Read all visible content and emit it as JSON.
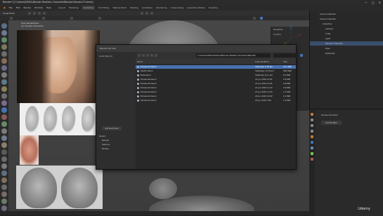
{
  "window": {
    "title": "Blender* [C:\\Users\\SAMI\\1\\Blender Realistic Character\\Blender\\Female-07.blend]",
    "controls": [
      "—",
      "□",
      "✕"
    ]
  },
  "menu": {
    "items": [
      "File",
      "Edit",
      "Render",
      "Window",
      "Help"
    ],
    "workspaces": [
      "Layout",
      "Modeling",
      "Sculpting",
      "UV Editing",
      "Texture Paint",
      "Shading",
      "Animation",
      "Rendering",
      "Compositing",
      "Geometry Nodes",
      "Scripting"
    ],
    "active_workspace": "Sculpting"
  },
  "viewport": {
    "mode": "Sculpt Mode",
    "overlay_text": [
      "User Perspective",
      "(1) Female Character"
    ],
    "mesh_name": "Female Character"
  },
  "file_dialog": {
    "title": "Blender File View",
    "path": "C:\\Users\\SAMI\\1\\Desktop\\Blender Realistic Character\\Blender\\",
    "columns": {
      "name": "Name",
      "date": "Date Modified",
      "size": "Size"
    },
    "files": [
      {
        "name": "Female-07.blend",
        "date": "Yesterday 1:39 pm",
        "size": "75.1 MiB",
        "selected": true
      },
      {
        "name": "Sketch.blend",
        "date": "Yesterday 11:50 pm",
        "size": "98.8 MiB",
        "selected": false
      },
      {
        "name": "Male.blend",
        "date": "Yesterday 6:11 pm",
        "size": "8.0 MiB",
        "selected": false
      },
      {
        "name": "Female-06.blend",
        "date": "21 Jun 2022 12:51",
        "size": "5.6 MiB",
        "selected": false
      },
      {
        "name": "Female-05.blend",
        "date": "21 Jun 2022 12:31",
        "size": "4.8 MiB",
        "selected": false
      },
      {
        "name": "Female-04.blend",
        "date": "21 Jun 2022 11:47",
        "size": "3.9 MiB",
        "selected": false
      },
      {
        "name": "Female-03.blend",
        "date": "21 Jun 2022 11:05",
        "size": "2.7 MiB",
        "selected": false
      },
      {
        "name": "Female-02.blend",
        "date": "20 Jun 2022 10:22",
        "size": "2.1 MiB",
        "selected": false
      },
      {
        "name": "Female-01.blend",
        "date": "20 Jun 2022 9:40",
        "size": "1.4 MiB",
        "selected": false
      }
    ],
    "sidebar": {
      "volume_label": "Local Disk (C:)",
      "add_bookmark": "Add Bookmark",
      "recent_label": "Recent",
      "recent": [
        "Blender",
        "Textures",
        "Models"
      ]
    }
  },
  "outliner": {
    "header": "Scene Collection",
    "rows": [
      {
        "label": "Scene Collection",
        "selected": false
      },
      {
        "label": "Collection",
        "selected": false
      },
      {
        "label": "Camera",
        "selected": false
      },
      {
        "label": "Cube",
        "selected": false
      },
      {
        "label": "Light",
        "selected": false
      },
      {
        "label": "Female Character",
        "selected": true
      },
      {
        "label": "Eyes",
        "selected": false
      },
      {
        "label": "Eyebrows",
        "selected": false
      }
    ]
  },
  "properties": {
    "object_name": "Female Character",
    "add_modifier": "Add Modifier"
  },
  "npanel": {
    "header": "Transform",
    "rows": [
      "Location",
      "Rotation",
      "Scale",
      "Dimensions"
    ]
  },
  "watermark": {
    "text": "Udemy"
  },
  "colors": {
    "accent": "#4772b3",
    "background": "#1d1d1d",
    "panel": "#2b2b2b"
  }
}
